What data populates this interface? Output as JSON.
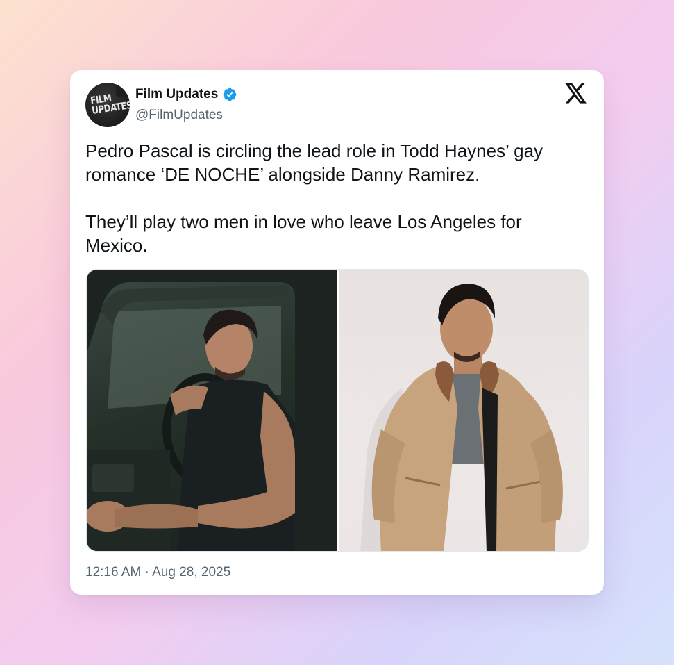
{
  "account": {
    "display_name": "Film Updates",
    "handle": "@FilmUpdates",
    "avatar_text_line1": "FILM",
    "avatar_text_line2": "UPDATES",
    "verified_color": "#1d9bf0"
  },
  "tweet": {
    "paragraph1": "Pedro Pascal is circling the lead role in Todd Haynes’ gay romance ‘DE NOCHE’ alongside Danny Ramirez.",
    "paragraph2": "They’ll play two men in love who leave Los Angeles for Mexico.",
    "timestamp": "12:16 AM · Aug 28, 2025"
  },
  "media": {
    "photos": [
      {
        "icon": "photo-man-in-truck"
      },
      {
        "icon": "photo-man-in-jacket"
      }
    ]
  },
  "brand": {
    "icon": "x-logo-icon"
  },
  "colors": {
    "text_primary": "#0f1419",
    "text_secondary": "#536471",
    "card_bg": "#ffffff"
  }
}
